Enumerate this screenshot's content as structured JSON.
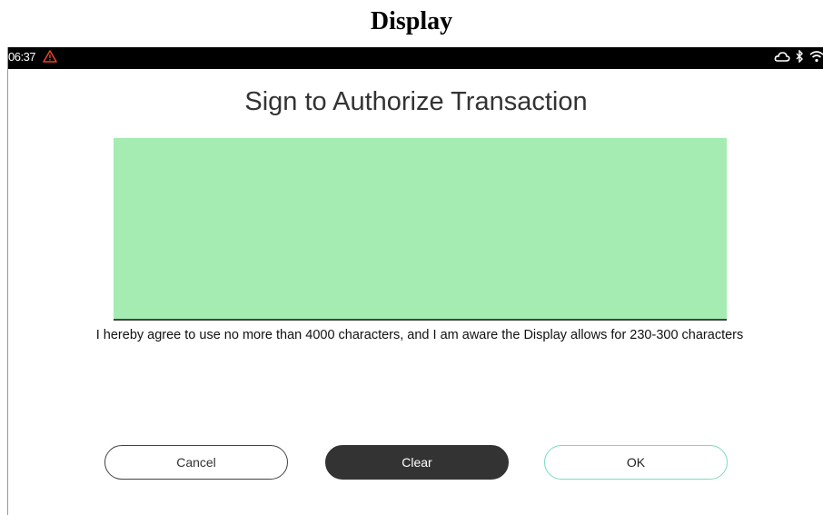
{
  "page": {
    "caption": "Display"
  },
  "status_bar": {
    "time": "06:37",
    "icons": [
      "warning-icon",
      "cloud-icon",
      "bluetooth-icon",
      "wifi-icon"
    ],
    "warning_color": "#e0452b"
  },
  "screen": {
    "title": "Sign to Authorize Transaction",
    "signature_area_color": "#a4ecb2",
    "agreement_text": "I hereby agree to use no more than 4000 characters, and I am aware the Display allows for 230-300 characters"
  },
  "buttons": {
    "cancel_label": "Cancel",
    "clear_label": "Clear",
    "ok_label": "OK",
    "ok_border_color": "#7ddbc2"
  }
}
